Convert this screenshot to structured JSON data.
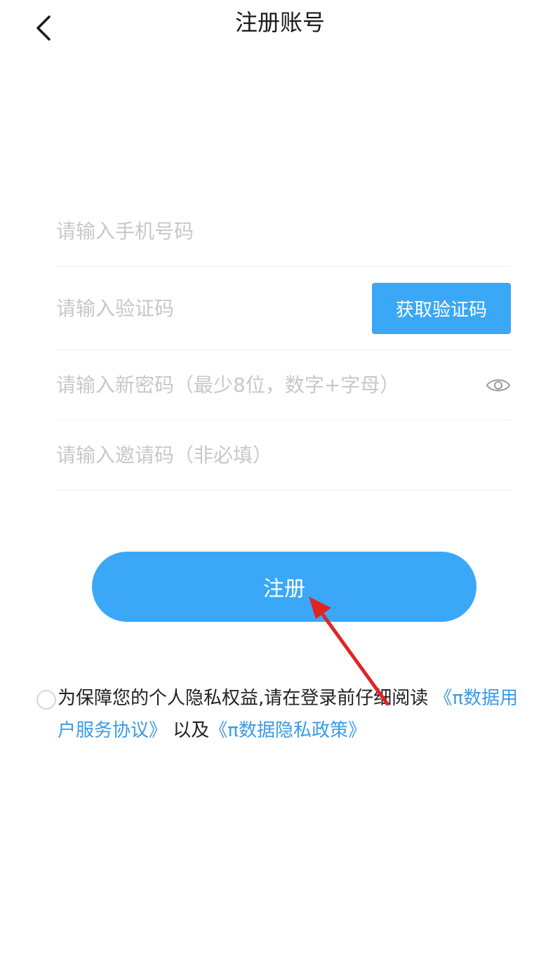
{
  "header": {
    "title": "注册账号",
    "back_icon": "chevron-left-icon"
  },
  "form": {
    "phone_placeholder": "请输入手机号码",
    "code_placeholder": "请输入验证码",
    "get_code_label": "获取验证码",
    "password_placeholder": "请输入新密码（最少8位，数字+字母）",
    "password_toggle_icon": "eye-icon",
    "invite_placeholder": "请输入邀请码（非必填）"
  },
  "submit_label": "注册",
  "agreement": {
    "prefix": "为保障您的个人隐私权益,请在登录前仔细阅读",
    "user_agreement_link": "《π数据用户服务协议》",
    "connector": "以及",
    "privacy_policy_link": "《π数据隐私政策》",
    "checked": false
  },
  "annotation": {
    "arrow_icon": "red-arrow-icon",
    "color": "#e02424"
  },
  "colors": {
    "accent": "#3aa8f7",
    "link": "#3a9be8"
  }
}
